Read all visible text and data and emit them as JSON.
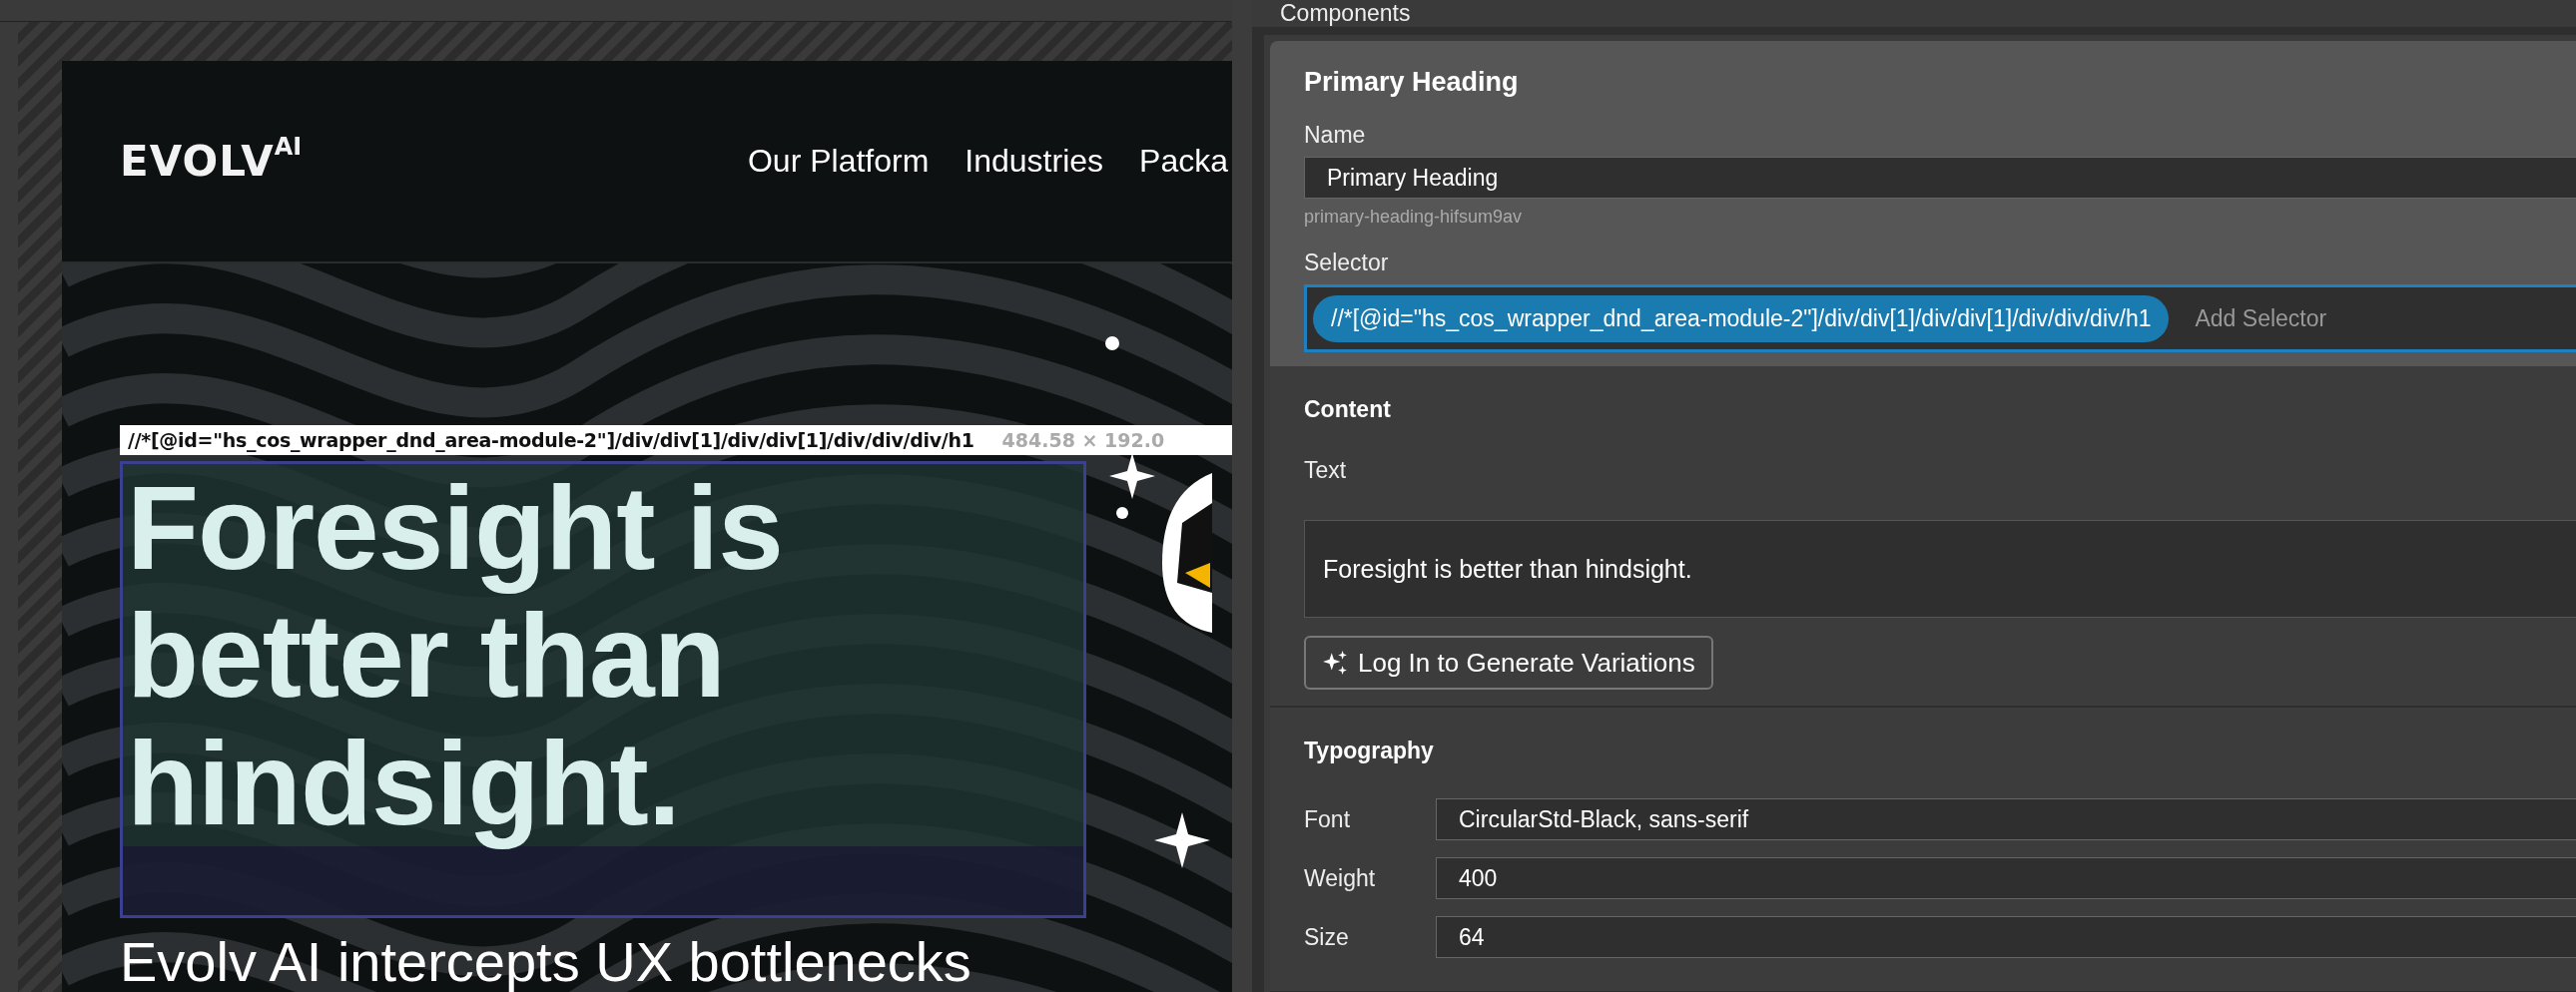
{
  "panel_title": "Components",
  "website": {
    "logo": "EVOLV",
    "logo_suffix": "AI",
    "nav": [
      "Our Platform",
      "Industries",
      "Packa"
    ],
    "element_label": {
      "xpath": "//*[@id=\"hs_cos_wrapper_dnd_area-module-2\"]/div/div[1]/div/div[1]/div/div/div/h1",
      "size": "484.58 × 192.0"
    },
    "heading": "Foresight is better than hindsight.",
    "subheading": "Evolv AI intercepts UX bottlenecks"
  },
  "component": {
    "title": "Primary Heading",
    "name_label": "Name",
    "name_value": "Primary Heading",
    "slug": "primary-heading-hifsum9av",
    "selector_label": "Selector",
    "selector_focused": true,
    "selectors": [
      "//*[@id=\"hs_cos_wrapper_dnd_area-module-2\"]/div/div[1]/div/div[1]/div/div/div/h1"
    ],
    "add_selector_placeholder": "Add Selector",
    "content_title": "Content",
    "text_label": "Text",
    "text_value": "Foresight is better than hindsight.",
    "generate_button": "Log In to Generate Variations",
    "typography_title": "Typography",
    "fields": [
      {
        "label": "Font",
        "value": "CircularStd-Black, sans-serif"
      },
      {
        "label": "Weight",
        "value": "400"
      },
      {
        "label": "Size",
        "value": "64"
      }
    ]
  }
}
